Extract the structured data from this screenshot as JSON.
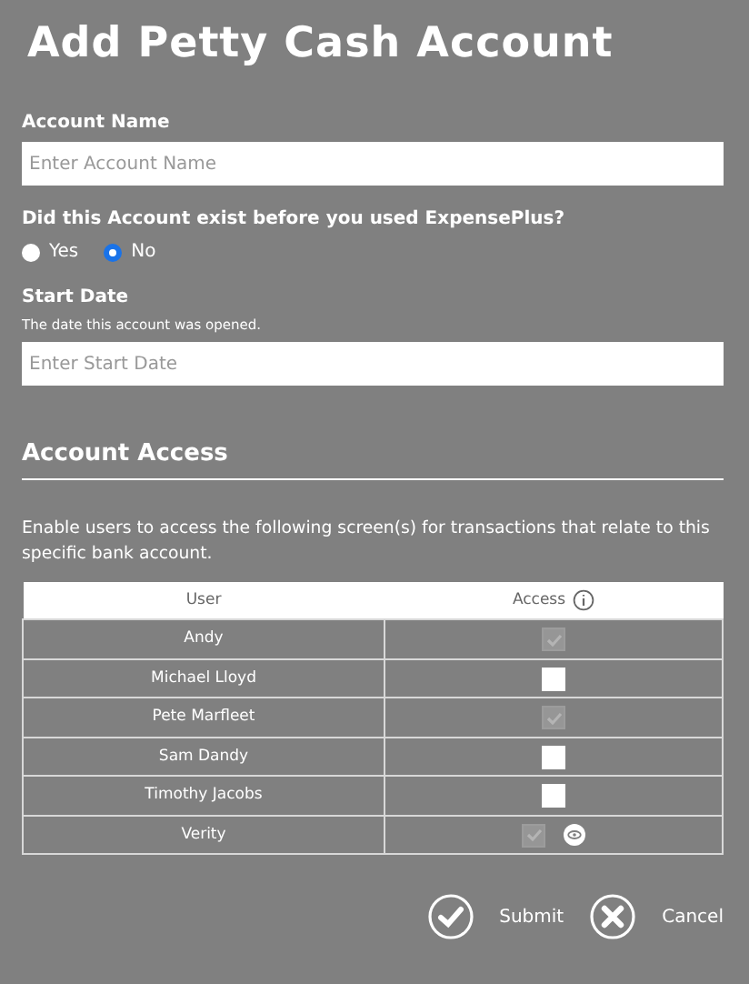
{
  "title": "Add Petty Cash Account",
  "account_name": {
    "label": "Account Name",
    "placeholder": "Enter Account Name"
  },
  "existed": {
    "question": "Did this Account exist before you used ExpensePlus?",
    "options": [
      {
        "label": "Yes",
        "selected": false
      },
      {
        "label": "No",
        "selected": true
      }
    ]
  },
  "start_date": {
    "label": "Start Date",
    "hint": "The date this account was opened.",
    "placeholder": "Enter Start Date"
  },
  "access": {
    "heading": "Account Access",
    "description": "Enable users to access the following screen(s) for transactions that relate to this specific bank account.",
    "columns": [
      "User",
      "Access"
    ],
    "rows": [
      {
        "user": "Andy",
        "checked": true,
        "disabled": true,
        "viewable": false
      },
      {
        "user": "Michael Lloyd",
        "checked": false,
        "disabled": false,
        "viewable": false
      },
      {
        "user": "Pete Marfleet",
        "checked": true,
        "disabled": true,
        "viewable": false
      },
      {
        "user": "Sam Dandy",
        "checked": false,
        "disabled": false,
        "viewable": false
      },
      {
        "user": "Timothy Jacobs",
        "checked": false,
        "disabled": false,
        "viewable": false
      },
      {
        "user": "Verity",
        "checked": true,
        "disabled": true,
        "viewable": true
      }
    ]
  },
  "buttons": [
    {
      "kind": "submit",
      "label": "Submit"
    },
    {
      "kind": "cancel",
      "label": "Cancel"
    }
  ]
}
